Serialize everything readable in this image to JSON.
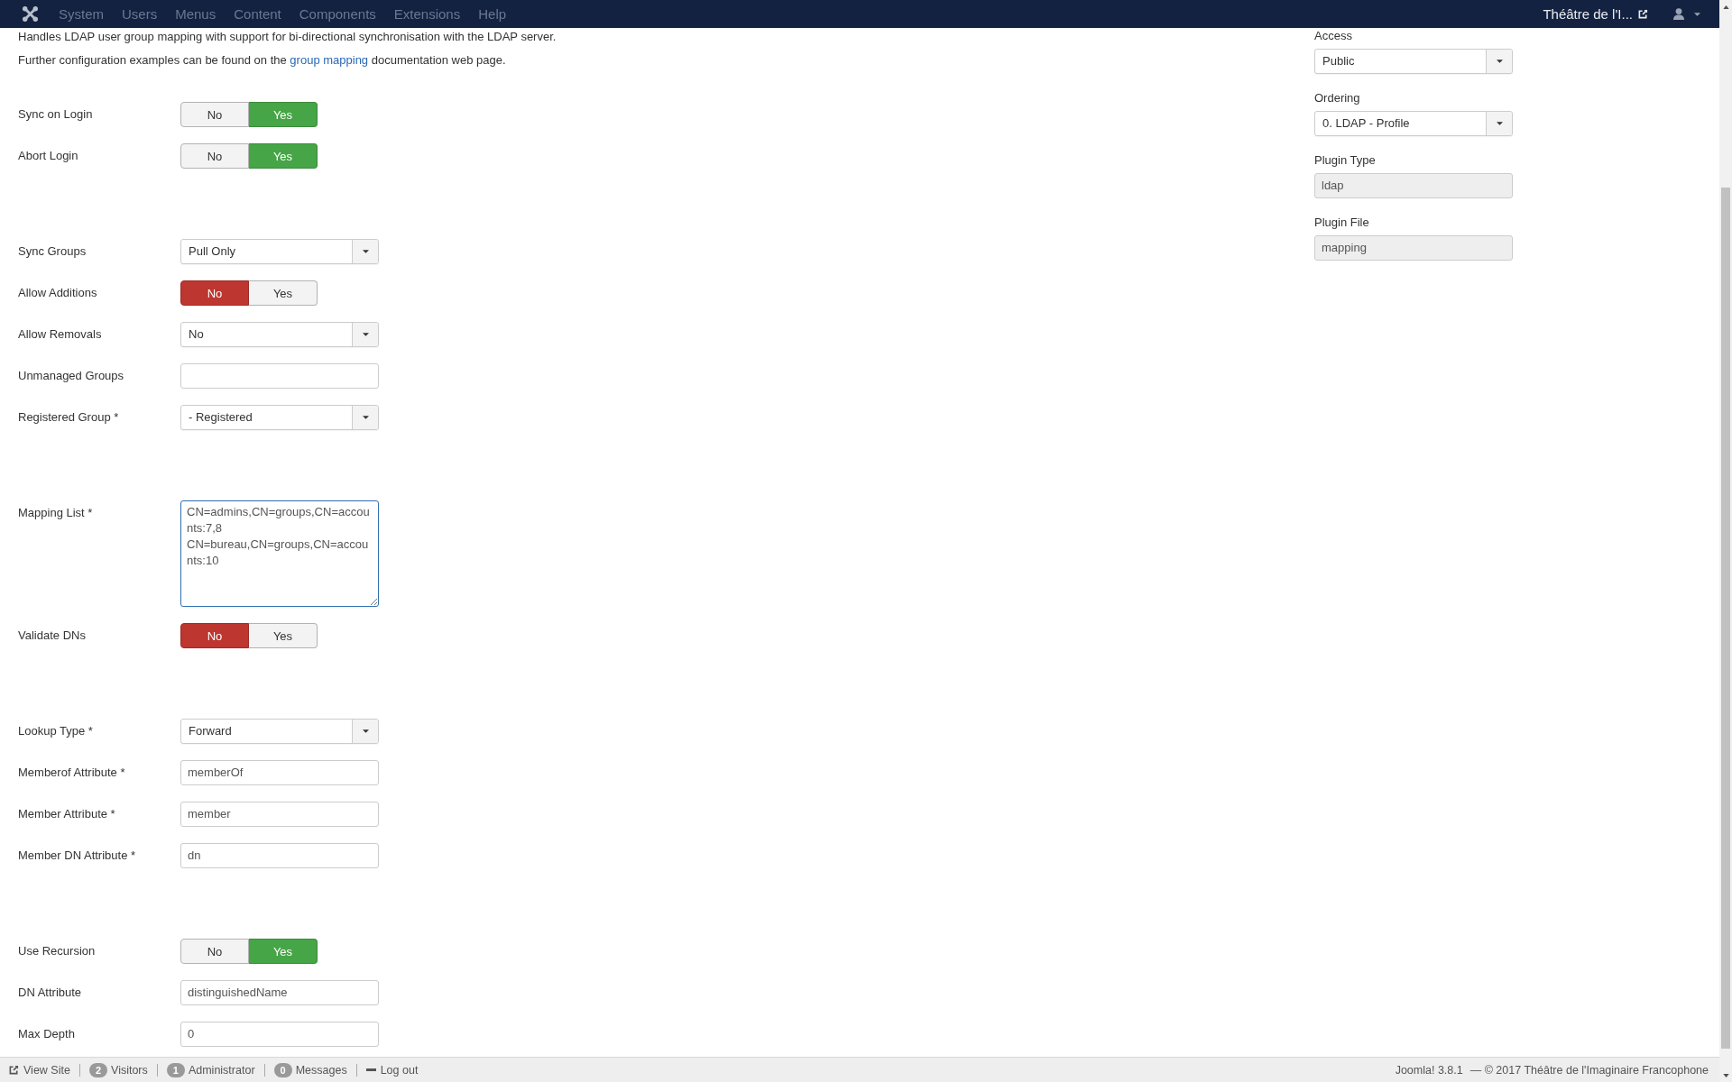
{
  "header": {
    "menu": [
      {
        "label": "System",
        "disabled": true
      },
      {
        "label": "Users",
        "disabled": true
      },
      {
        "label": "Menus",
        "disabled": true
      },
      {
        "label": "Content",
        "disabled": true
      },
      {
        "label": "Components",
        "disabled": true
      },
      {
        "label": "Extensions",
        "disabled": true
      },
      {
        "label": "Help",
        "disabled": true
      }
    ],
    "site_link": {
      "label": "Théâtre de l'I..."
    }
  },
  "description": {
    "intro": "Handles LDAP user group mapping with support for bi-directional synchronisation with the LDAP server.",
    "further": {
      "before": "Further configuration examples can be found on the",
      "link": "group mapping",
      "after": "documentation web page."
    }
  },
  "sections": [
    {
      "fields": [
        {
          "label": "Sync on Login",
          "kind": "toggle",
          "options": [
            {
              "label": "No",
              "selected": false
            },
            {
              "label": "Yes",
              "selected": true
            }
          ]
        },
        {
          "label": "Abort Login",
          "kind": "toggle",
          "options": [
            {
              "label": "No",
              "selected": false
            },
            {
              "label": "Yes",
              "selected": true
            }
          ]
        }
      ]
    },
    {
      "fields": [
        {
          "label": "Sync Groups",
          "kind": "select",
          "value": "Pull Only"
        },
        {
          "label": "Allow Additions",
          "kind": "toggle",
          "options": [
            {
              "label": "No",
              "selected": true
            },
            {
              "label": "Yes",
              "selected": false
            }
          ]
        },
        {
          "label": "Allow Removals",
          "kind": "select",
          "value": "No"
        },
        {
          "label": "Unmanaged Groups",
          "kind": "text"
        },
        {
          "label": "Registered Group *",
          "kind": "select",
          "value": "- Registered"
        }
      ]
    },
    {
      "fields": [
        {
          "label": "Mapping List *",
          "kind": "textarea",
          "focused": true,
          "value": "CN=admins,CN=groups,CN=accounts:7,8\nCN=bureau,CN=groups,CN=accounts:10"
        },
        {
          "label": "Validate DNs",
          "kind": "toggle",
          "options": [
            {
              "label": "No",
              "selected": true
            },
            {
              "label": "Yes",
              "selected": false
            }
          ]
        }
      ]
    },
    {
      "fields": [
        {
          "label": "Lookup Type *",
          "kind": "select",
          "value": "Forward"
        },
        {
          "label": "Memberof Attribute *",
          "kind": "text",
          "value": "memberOf"
        },
        {
          "label": "Member Attribute *",
          "kind": "text",
          "value": "member"
        },
        {
          "label": "Member DN Attribute *",
          "kind": "text",
          "value": "dn"
        }
      ]
    },
    {
      "fields": [
        {
          "label": "Use Recursion",
          "kind": "toggle",
          "options": [
            {
              "label": "No",
              "selected": false
            },
            {
              "label": "Yes",
              "selected": true
            }
          ]
        },
        {
          "label": "DN Attribute",
          "kind": "text",
          "value": "distinguishedName"
        },
        {
          "label": "Max Depth",
          "kind": "text",
          "value": "0"
        }
      ]
    }
  ],
  "sidebar": {
    "fields": [
      {
        "label": "Access",
        "kind": "select",
        "value": "Public"
      },
      {
        "label": "Ordering",
        "kind": "select",
        "value": "0. LDAP - Profile"
      },
      {
        "label": "Plugin Type",
        "kind": "readonly",
        "value": "ldap"
      },
      {
        "label": "Plugin File",
        "kind": "readonly",
        "value": "mapping"
      }
    ]
  },
  "status_bar": {
    "items": [
      {
        "kind": "link",
        "label": "View Site"
      },
      {
        "kind": "count",
        "count": "2",
        "label": "Visitors"
      },
      {
        "kind": "count",
        "count": "1",
        "label": "Administrator"
      },
      {
        "kind": "count",
        "count": "0",
        "label": "Messages"
      },
      {
        "kind": "logout",
        "label": "Log out"
      }
    ],
    "version": "Joomla! 3.8.1",
    "copyright": "— © 2017 Théâtre de l'Imaginaire Francophone"
  }
}
